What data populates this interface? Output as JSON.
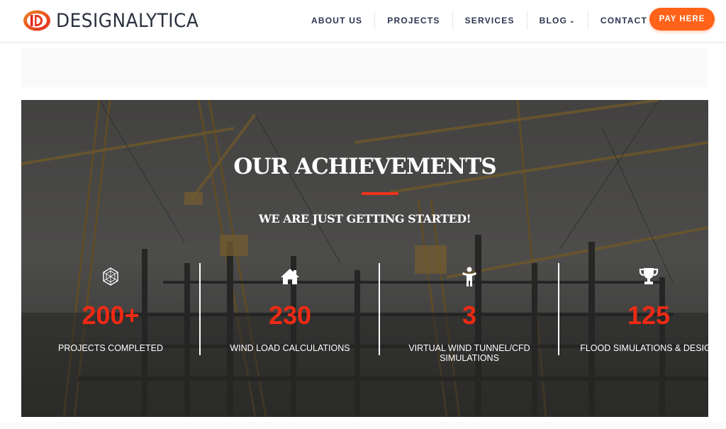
{
  "header": {
    "brand": "DESIGNALYTICA",
    "nav": [
      {
        "label": "ABOUT US"
      },
      {
        "label": "PROJECTS"
      },
      {
        "label": "SERVICES"
      },
      {
        "label": "BLOG",
        "has_dropdown": true
      },
      {
        "label": "CONTACT"
      }
    ],
    "cta_label": "PAY HERE"
  },
  "achievements": {
    "title": "OUR ACHIEVEMENTS",
    "subtitle": "WE ARE JUST GETTING STARTED!",
    "stats": [
      {
        "icon": "hexagon-icon",
        "value": "200+",
        "label": "PROJECTS COMPLETED"
      },
      {
        "icon": "home-icon",
        "value": "230",
        "label": "WIND LOAD CALCULATIONS"
      },
      {
        "icon": "person-icon",
        "value": "3",
        "label": "VIRTUAL WIND TUNNEL/CFD SIMULATIONS"
      },
      {
        "icon": "trophy-icon",
        "value": "125",
        "label": "FLOOD SIMULATIONS & DESIGN"
      }
    ]
  },
  "colors": {
    "accent_orange": "#ff6219",
    "stat_red": "#ee2a14",
    "nav_text": "#2b3550",
    "logo_red": "#e8381f"
  }
}
